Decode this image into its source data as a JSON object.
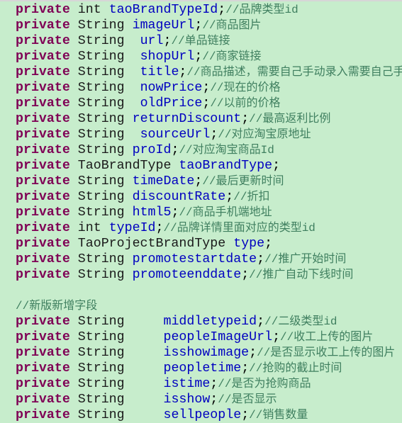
{
  "code": {
    "fields": [
      {
        "keyword": "private",
        "type": "int",
        "name": "taoBrandTypeId",
        "comment": "//品牌类型id"
      },
      {
        "keyword": "private",
        "type": "String",
        "name": "imageUrl",
        "comment": "//商品图片"
      },
      {
        "keyword": "private",
        "type": "String",
        "name": "url",
        "comment": "//单品链接"
      },
      {
        "keyword": "private",
        "type": "String",
        "name": "shopUrl",
        "comment": "//商家链接"
      },
      {
        "keyword": "private",
        "type": "String",
        "name": "title",
        "comment": "//商品描述，需要自己手动录入需要自己手动"
      },
      {
        "keyword": "private",
        "type": "String",
        "name": "nowPrice",
        "comment": "//现在的价格"
      },
      {
        "keyword": "private",
        "type": "String",
        "name": "oldPrice",
        "comment": "//以前的价格"
      },
      {
        "keyword": "private",
        "type": "String",
        "name": "returnDiscount",
        "comment": "//最高返利比例"
      },
      {
        "keyword": "private",
        "type": "String",
        "name": "sourceUrl",
        "comment": "//对应淘宝原地址"
      },
      {
        "keyword": "private",
        "type": "String",
        "name": "proId",
        "comment": "//对应淘宝商品Id"
      },
      {
        "keyword": "private",
        "type": "TaoBrandType",
        "name": "taoBrandType",
        "comment": ""
      },
      {
        "keyword": "private",
        "type": "String",
        "name": "timeDate",
        "comment": "//最后更新时间"
      },
      {
        "keyword": "private",
        "type": "String",
        "name": "discountRate",
        "comment": "//折扣"
      },
      {
        "keyword": "private",
        "type": "String",
        "name": "html5",
        "comment": "//商品手机端地址"
      },
      {
        "keyword": "private",
        "type": "int",
        "name": "typeId",
        "comment": "//品牌详情里面对应的类型id"
      },
      {
        "keyword": "private",
        "type": "TaoProjectBrandType",
        "name": "type",
        "comment": ""
      },
      {
        "keyword": "private",
        "type": "String",
        "name": "promotestartdate",
        "comment": "//推广开始时间"
      },
      {
        "keyword": "private",
        "type": "String",
        "name": "promoteenddate",
        "comment": "//推广自动下线时间"
      }
    ],
    "section_comment": "//新版新增字段",
    "new_fields": [
      {
        "keyword": "private",
        "type": "String",
        "name": "middletypeid",
        "comment": "//二级类型id"
      },
      {
        "keyword": "private",
        "type": "String",
        "name": "peopleImageUrl",
        "comment": "//收工上传的图片"
      },
      {
        "keyword": "private",
        "type": "String",
        "name": "isshowimage",
        "comment": "//是否显示收工上传的图片"
      },
      {
        "keyword": "private",
        "type": "String",
        "name": "peopletime",
        "comment": "//抢购的截止时间"
      },
      {
        "keyword": "private",
        "type": "String",
        "name": "istime",
        "comment": "//是否为抢购商品"
      },
      {
        "keyword": "private",
        "type": "String",
        "name": "isshow",
        "comment": "//是否显示"
      },
      {
        "keyword": "private",
        "type": "String",
        "name": "sellpeople",
        "comment": "//销售数量"
      }
    ]
  }
}
